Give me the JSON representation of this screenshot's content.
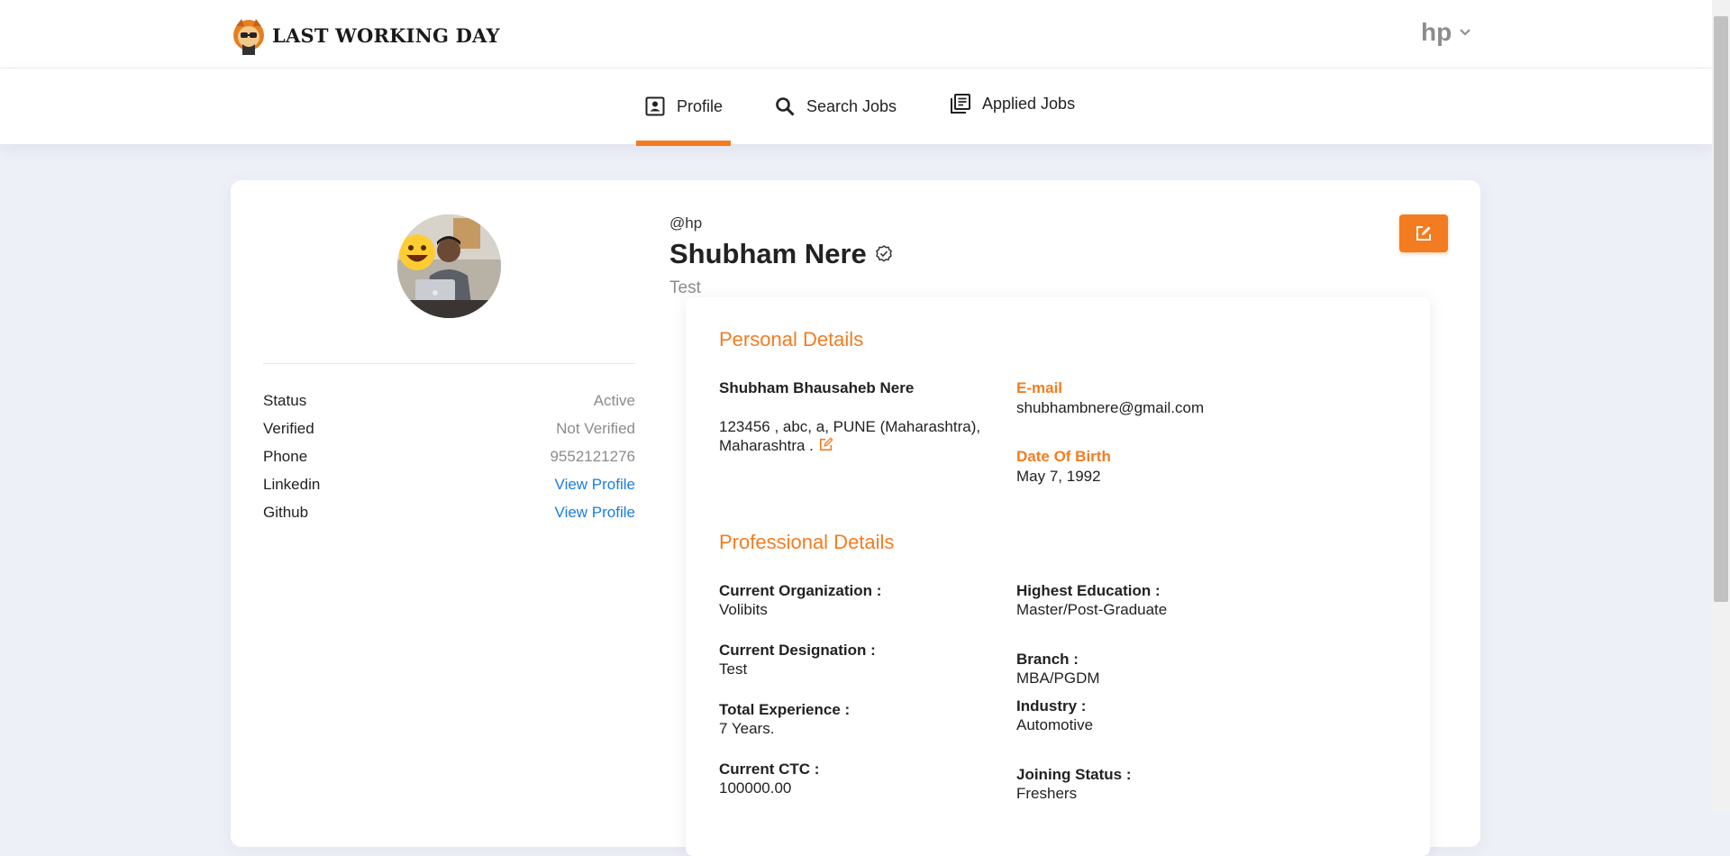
{
  "header": {
    "logo_text": "LAST WORKING DAY",
    "username": "hp"
  },
  "nav": {
    "tabs": [
      {
        "label": "Profile",
        "icon": "profile-icon",
        "active": true
      },
      {
        "label": "Search Jobs",
        "icon": "search-icon",
        "active": false
      },
      {
        "label": "Applied Jobs",
        "icon": "list-icon",
        "active": false
      }
    ]
  },
  "sidebar": {
    "rows": [
      {
        "label": "Status",
        "value": "Active"
      },
      {
        "label": "Verified",
        "value": "Not Verified"
      },
      {
        "label": "Phone",
        "value": "9552121276"
      },
      {
        "label": "Linkedin",
        "value": "View Profile"
      },
      {
        "label": "Github",
        "value": "View Profile"
      }
    ]
  },
  "profile": {
    "handle": "@hp",
    "name": "Shubham Nere",
    "designation": "Test"
  },
  "personal": {
    "title": "Personal Details",
    "full_name": "Shubham Bhausaheb Nere",
    "address": "123456 , abc, a, PUNE (Maharashtra), Maharashtra .",
    "email_label": "E-mail",
    "email": "shubhambnere@gmail.com",
    "dob_label": "Date Of Birth",
    "dob": "May 7, 1992"
  },
  "professional": {
    "title": "Professional Details",
    "left": [
      {
        "label": "Current Organization :",
        "value": "Volibits"
      },
      {
        "label": "Current Designation :",
        "value": "Test"
      },
      {
        "label": "Total Experience :",
        "value": "7 Years."
      },
      {
        "label": "Current CTC :",
        "value": "100000.00"
      }
    ],
    "right": [
      {
        "label": "Highest Education :",
        "value": "Master/Post-Graduate"
      },
      {
        "label": "Branch :",
        "value": "MBA/PGDM"
      },
      {
        "label": "Industry :",
        "value": "Automotive"
      },
      {
        "label": "Joining Status :",
        "value": "Freshers"
      }
    ]
  },
  "colors": {
    "accent": "#f47c20",
    "link": "#1a7ee0",
    "muted": "#8c8c8c",
    "background": "#eef0f7"
  }
}
